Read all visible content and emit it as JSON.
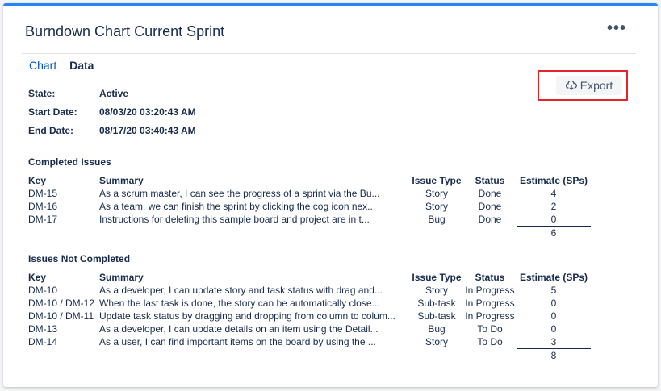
{
  "header": {
    "title": "Burndown Chart Current Sprint",
    "more_label": "•••"
  },
  "tabs": [
    {
      "label": "Chart"
    },
    {
      "label": "Data"
    }
  ],
  "sprint": {
    "state_label": "State:",
    "state_value": "Active",
    "start_label": "Start Date:",
    "start_value": "08/03/20 03:20:43 AM",
    "end_label": "End Date:",
    "end_value": "08/17/20 03:40:43 AM"
  },
  "export": {
    "label": "Export",
    "icon": "cloud-download-icon"
  },
  "columns": {
    "key": "Key",
    "summary": "Summary",
    "issue_type": "Issue Type",
    "status": "Status",
    "estimate": "Estimate (SPs)"
  },
  "completed": {
    "title": "Completed Issues",
    "rows": [
      {
        "key": "DM-15",
        "summary": "As a scrum master, I can see the progress of a sprint via the Bu...",
        "type": "Story",
        "status": "Done",
        "estimate": "4"
      },
      {
        "key": "DM-16",
        "summary": "As a team, we can finish the sprint by clicking the cog icon nex...",
        "type": "Story",
        "status": "Done",
        "estimate": "2"
      },
      {
        "key": "DM-17",
        "summary": "Instructions for deleting this sample board and project are in t...",
        "type": "Bug",
        "status": "Done",
        "estimate": "0"
      }
    ],
    "total": "6"
  },
  "not_completed": {
    "title": "Issues Not Completed",
    "rows": [
      {
        "key": "DM-10",
        "summary": "As a developer, I can update story and task status with drag and...",
        "type": "Story",
        "status": "In Progress",
        "estimate": "5"
      },
      {
        "key": "DM-10 / DM-12",
        "summary": "When the last task is done, the story can be automatically close...",
        "type": "Sub-task",
        "status": "In Progress",
        "estimate": "0"
      },
      {
        "key": "DM-10 / DM-11",
        "summary": "Update task status by dragging and dropping from column to colum...",
        "type": "Sub-task",
        "status": "In Progress",
        "estimate": "0"
      },
      {
        "key": "DM-13",
        "summary": "As a developer, I can update details on an item using the Detail...",
        "type": "Bug",
        "status": "To Do",
        "estimate": "0"
      },
      {
        "key": "DM-14",
        "summary": "As a user, I can find important items on the board by using the ...",
        "type": "Story",
        "status": "To Do",
        "estimate": "3"
      }
    ],
    "total": "8"
  },
  "colors": {
    "accent": "#2684ff",
    "link": "#0052cc",
    "text": "#172b4d",
    "highlight": "#e5252a"
  }
}
